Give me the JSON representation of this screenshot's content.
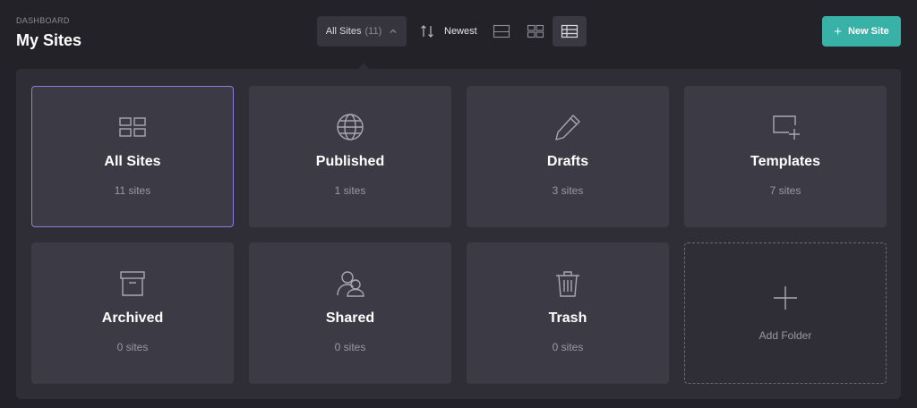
{
  "header": {
    "breadcrumb": "DASHBOARD",
    "title": "My Sites"
  },
  "toolbar": {
    "filter_label": "All Sites",
    "filter_count": "(11)",
    "sort_label": "Newest",
    "views": [
      "list-view-icon",
      "grid-view-icon",
      "card-view-icon"
    ],
    "active_view": "card-view-icon",
    "new_site_label": "New Site"
  },
  "folders": [
    {
      "name": "All Sites",
      "count": "11 sites",
      "icon": "grid-icon",
      "selected": true
    },
    {
      "name": "Published",
      "count": "1 sites",
      "icon": "globe-icon"
    },
    {
      "name": "Drafts",
      "count": "3 sites",
      "icon": "pencil-icon"
    },
    {
      "name": "Templates",
      "count": "7 sites",
      "icon": "template-icon"
    },
    {
      "name": "Archived",
      "count": "0 sites",
      "icon": "archive-box-icon"
    },
    {
      "name": "Shared",
      "count": "0 sites",
      "icon": "users-icon"
    },
    {
      "name": "Trash",
      "count": "0 sites",
      "icon": "trash-icon"
    }
  ],
  "add_folder_label": "Add Folder",
  "colors": {
    "background": "#232229",
    "panel": "#2f2e37",
    "card": "#3c3b45",
    "accent": "#38b2a7",
    "selected_outline": "#8c7cdc"
  }
}
